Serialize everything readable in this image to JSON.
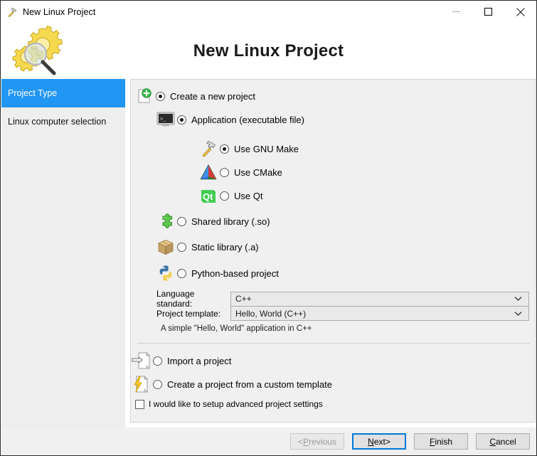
{
  "window": {
    "title": "New Linux Project",
    "app_icon": "hammer-icon",
    "minimize_label": "Minimize",
    "maximize_label": "Maximize",
    "close_label": "Close"
  },
  "header": {
    "title": "New Linux Project",
    "icon": "gears-magnifier-icon"
  },
  "sidebar": {
    "items": [
      {
        "label": "Project Type",
        "selected": true
      },
      {
        "label": "Linux computer selection",
        "selected": false
      }
    ],
    "selected_color": "#2196f3"
  },
  "main": {
    "options": [
      {
        "id": "create-new-project",
        "label": "Create a new project",
        "icon": "new-document-icon",
        "checked": true,
        "indent": 0
      },
      {
        "id": "application-executable",
        "label": "Application (executable file)",
        "icon": "terminal-icon",
        "checked": true,
        "indent": 1
      },
      {
        "id": "use-gnu-make",
        "label": "Use GNU Make",
        "icon": "hammer-icon",
        "checked": true,
        "indent": 2
      },
      {
        "id": "use-cmake",
        "label": "Use CMake",
        "icon": "cmake-triangle-icon",
        "checked": false,
        "indent": 2
      },
      {
        "id": "use-qt",
        "label": "Use Qt",
        "icon": "qt-icon",
        "checked": false,
        "indent": 2
      },
      {
        "id": "shared-library",
        "label": "Shared library (.so)",
        "icon": "puzzle-piece-icon",
        "checked": false,
        "indent": 1
      },
      {
        "id": "static-library",
        "label": "Static library (.a)",
        "icon": "box-icon",
        "checked": false,
        "indent": 1
      },
      {
        "id": "python-based-project",
        "label": "Python-based project",
        "icon": "python-icon",
        "checked": false,
        "indent": 1
      }
    ],
    "fields": [
      {
        "id": "language-standard",
        "label": "Language standard:",
        "value": "C++"
      },
      {
        "id": "project-template",
        "label": "Project template:",
        "value": "Hello, World (C++)"
      }
    ],
    "template_description": "A simple \"Hello, World\" application in C++",
    "bottom_options": [
      {
        "id": "import-a-project",
        "label": "Import a project",
        "icon": "import-document-icon",
        "checked": false
      },
      {
        "id": "custom-template-project",
        "label": "Create a project from a custom template",
        "icon": "lightning-document-icon",
        "checked": false
      }
    ],
    "advanced_checkbox": {
      "label": "I would like to setup advanced project settings",
      "checked": false
    }
  },
  "footer": {
    "buttons": [
      {
        "id": "previous",
        "prefix": "< ",
        "mnemonic": "P",
        "rest": "revious",
        "suffix": "",
        "disabled": true,
        "default": false
      },
      {
        "id": "next",
        "prefix": "",
        "mnemonic": "N",
        "rest": "ext",
        "suffix": " >",
        "disabled": false,
        "default": true
      },
      {
        "id": "finish",
        "prefix": "",
        "mnemonic": "F",
        "rest": "inish",
        "suffix": "",
        "disabled": false,
        "default": false
      },
      {
        "id": "cancel",
        "prefix": "",
        "mnemonic": "C",
        "rest": "ancel",
        "suffix": "",
        "disabled": false,
        "default": false
      }
    ]
  }
}
